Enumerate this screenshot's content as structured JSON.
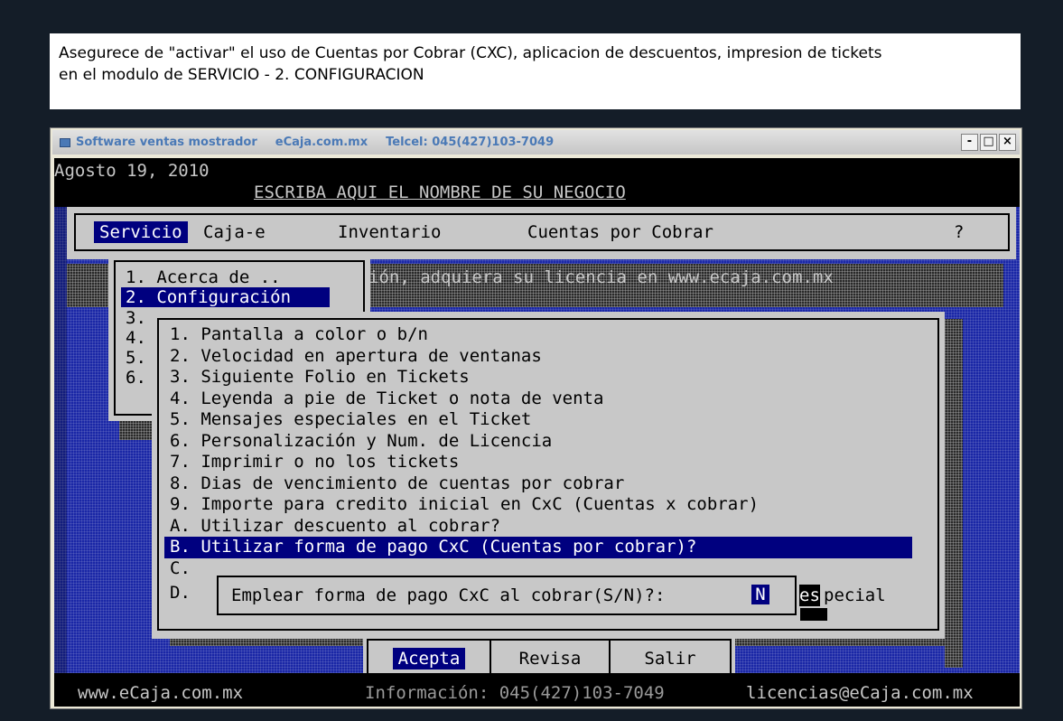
{
  "note": {
    "line1": "Asegurece de \"activar\" el uso de Cuentas por Cobrar (CXC), aplicacion de descuentos, impresion de tickets",
    "line2": "en el modulo de SERVICIO - 2. CONFIGURACION"
  },
  "window": {
    "title1": "Software ventas mostrador",
    "title2": "eCaja.com.mx",
    "title3": "Telcel: 045(427)103-7049",
    "min": "-",
    "max": "□",
    "close": "×"
  },
  "console": {
    "date": "Agosto 19, 2010",
    "business": "ESCRIBA AQUI EL NOMBRE DE SU NEGOCIO",
    "menubar": [
      "Servicio",
      "Caja-e",
      "Inventario",
      "Cuentas por Cobrar",
      "?"
    ],
    "license_msg": "ión, adquiera su licencia en www.ecaja.com.mx",
    "service_menu": [
      "1. Acerca de ..",
      "2. Configuración",
      "3.",
      "4.",
      "5.",
      "6."
    ],
    "config_items": [
      "1. Pantalla a color o b/n",
      "2. Velocidad en apertura de ventanas",
      "3. Siguiente Folio en Tickets",
      "4. Leyenda a pie de Ticket o nota de venta",
      "5. Mensajes especiales en el Ticket",
      "6. Personalización y Num. de Licencia",
      "7. Imprimir o no los tickets",
      "8. Dias de vencimiento de cuentas por cobrar",
      "9. Importe para credito inicial en CxC (Cuentas x cobrar)",
      "A. Utilizar descuento al cobrar?",
      "B. Utilizar forma de pago CxC (Cuentas por cobrar)?",
      "C.",
      "D."
    ],
    "prompt": "Emplear forma de pago CxC al cobrar(S/N)?:",
    "prompt_value": "N",
    "trailing_es": "es",
    "trailing_pecial": "pecial",
    "buttons": [
      "Acepta",
      "Revisa",
      "Salir"
    ],
    "footer_left": "www.eCaja.com.mx",
    "footer_mid": "Información: 045(427)103-7049",
    "footer_right": "licencias@eCaja.com.mx"
  }
}
